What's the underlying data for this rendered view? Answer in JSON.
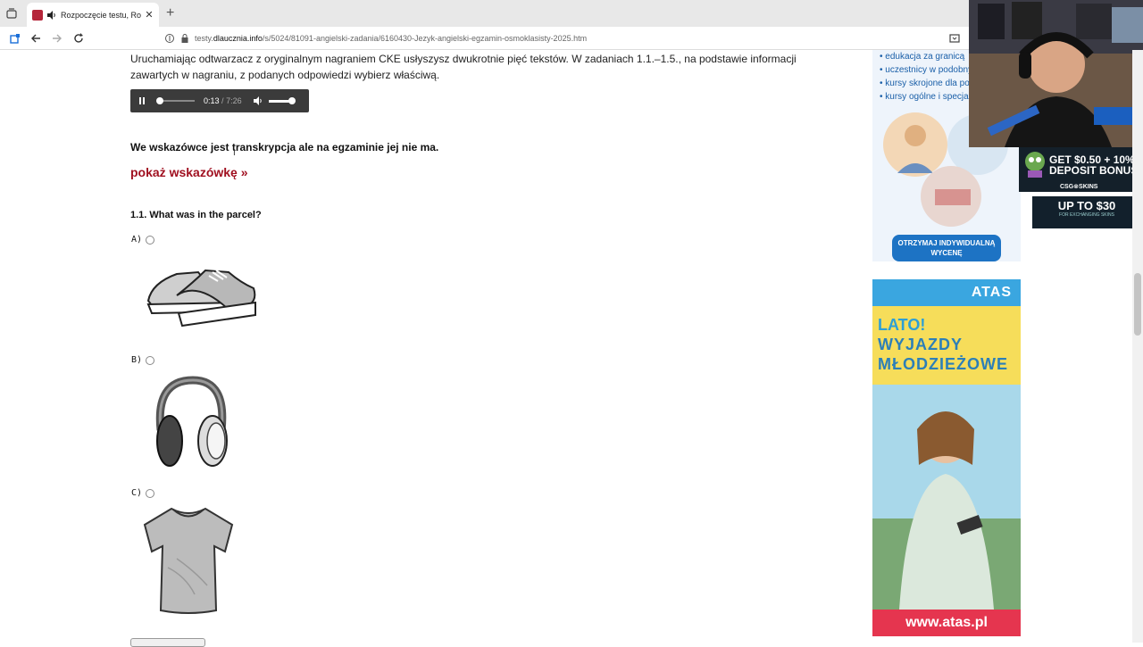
{
  "browser": {
    "tab_title": "Rozpoczęcie testu, Rozwiąż",
    "tab_close": "✕",
    "newtab": "+",
    "url_prefix": "testy.",
    "url_domain": "dlaucznia.info",
    "url_path": "/s/5024/81091-angielski-zadania/6160430-Jezyk-angielski-egzamin-osmoklasisty-2025.htm"
  },
  "page": {
    "intro": "Uruchamiając odtwarzacz z oryginalnym nagraniem CKE usłyszysz dwukrotnie pięć tekstów. W zadaniach 1.1.–1.5., na podstawie informacji zawartych w nagraniu, z podanych odpowiedzi wybierz właściwą.",
    "player": {
      "current": "0:13",
      "separator": "/",
      "total": "7:26",
      "progress": 0.03
    },
    "hint_note": "We wskazówce jest transkrypcja ale na egzaminie jej nie ma.",
    "show_hint": "pokaż wskazówkę »",
    "question": "1.1. What was in the parcel?",
    "options": [
      {
        "label": "A)",
        "picture": "sneakers"
      },
      {
        "label": "B)",
        "picture": "headphones"
      },
      {
        "label": "C)",
        "picture": "t-shirt"
      }
    ]
  },
  "ads": {
    "ad1_items": [
      "• edukacja za granicą",
      "• uczestnicy w podobnym",
      "• kursy skrojone dla potrzeb",
      "• kursy ogólne i specjalistyczne"
    ],
    "ad1_cta": "OTRZYMAJ INDYWIDUALNĄ WYCENĘ",
    "ad2_brand": "ATAS",
    "ad2_lato": "LATO!",
    "ad2_line1": "WYJAZDY",
    "ad2_line2": "MŁODZIEŻOWE",
    "ad2_url": "www.atas.pl"
  },
  "overlay": {
    "promo1_line1": "GET $0.50 + 10%",
    "promo1_line2": "DEPOSIT BONUS",
    "promo1_brand": "CSG⊗SKINS",
    "promo2_big": "UP TO $30",
    "promo2_small": "FOR EXCHANGING SKINS"
  }
}
